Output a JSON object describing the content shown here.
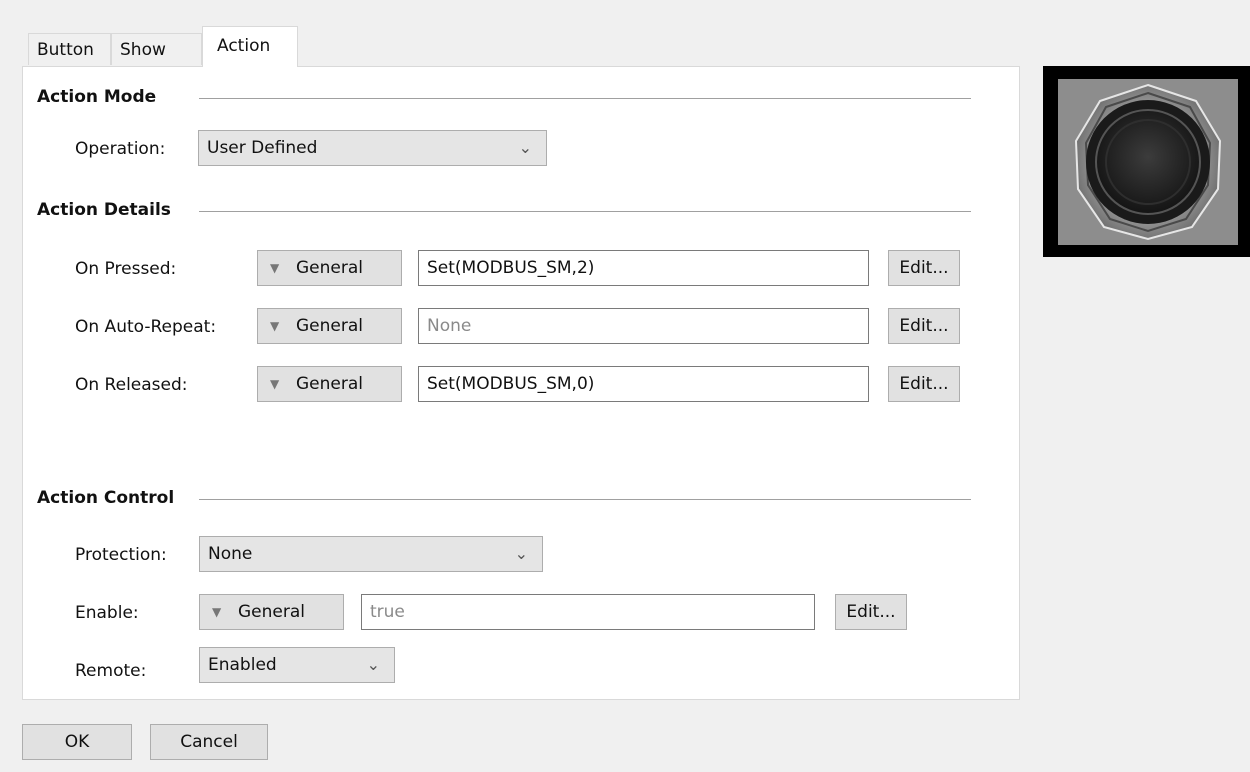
{
  "tabs": [
    {
      "label": "Button"
    },
    {
      "label": "Show"
    },
    {
      "label": "Action"
    }
  ],
  "action_mode": {
    "title": "Action Mode",
    "operation_label": "Operation:",
    "operation_value": "User Defined"
  },
  "action_details": {
    "title": "Action Details",
    "rows": [
      {
        "label": "On Pressed:",
        "type": "General",
        "value": "Set(MODBUS_SM,2)",
        "placeholder": "",
        "edit": "Edit..."
      },
      {
        "label": "On Auto-Repeat:",
        "type": "General",
        "value": "",
        "placeholder": "None",
        "edit": "Edit..."
      },
      {
        "label": "On Released:",
        "type": "General",
        "value": "Set(MODBUS_SM,0)",
        "placeholder": "",
        "edit": "Edit..."
      }
    ]
  },
  "action_control": {
    "title": "Action Control",
    "protection_label": "Protection:",
    "protection_value": "None",
    "enable_label": "Enable:",
    "enable_type": "General",
    "enable_placeholder": "true",
    "enable_edit": "Edit...",
    "remote_label": "Remote:",
    "remote_value": "Enabled"
  },
  "footer": {
    "ok": "OK",
    "cancel": "Cancel"
  },
  "icons": {
    "dropdown": "chevron-down-icon",
    "type_menu": "triangle-down-icon",
    "preview": "push-button-preview"
  },
  "colors": {
    "panel_bg": "#ffffff",
    "window_bg": "#f0f0f0",
    "button_bg": "#e1e1e1",
    "preview_bg": "#000000"
  }
}
